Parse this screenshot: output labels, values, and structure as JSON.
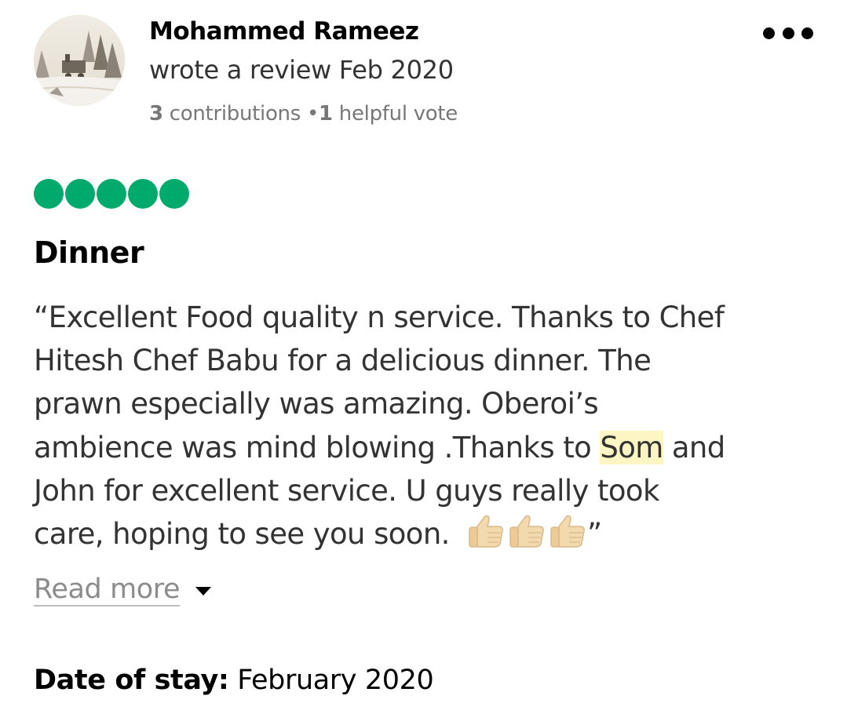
{
  "review": {
    "author": {
      "name": "Mohammed Rameez",
      "action": "wrote a review",
      "date": "Feb 2020",
      "contributions_count": "3",
      "contributions_label": "contributions",
      "separator": "•",
      "helpful_count": "1",
      "helpful_label": "helpful vote"
    },
    "menu_icon": "more-horizontal-icon",
    "rating": {
      "value": 5,
      "max": 5,
      "color": "#00aa6c"
    },
    "title": "Dinner",
    "body_lines": [
      "“Excellent Food quality n service. Thanks to Chef",
      "Hitesh Chef Babu for a delicious dinner. The",
      "prawn especially was amazing. Oberoi’s",
      "ambience was mind blowing .Thanks to ",
      "John for excellent service. U guys really took",
      "care, hoping to see you soon. "
    ],
    "body_line4_highlight": "Som",
    "body_line4_tail": " and",
    "body_end_quote": "”",
    "emoji_icons": [
      "thumbs-up-icon",
      "thumbs-up-icon",
      "thumbs-up-icon"
    ],
    "highlight_color": "#fdf5c4",
    "read_more_label": "Read more",
    "stay_label": "Date of stay:",
    "stay_value": "February 2020"
  }
}
